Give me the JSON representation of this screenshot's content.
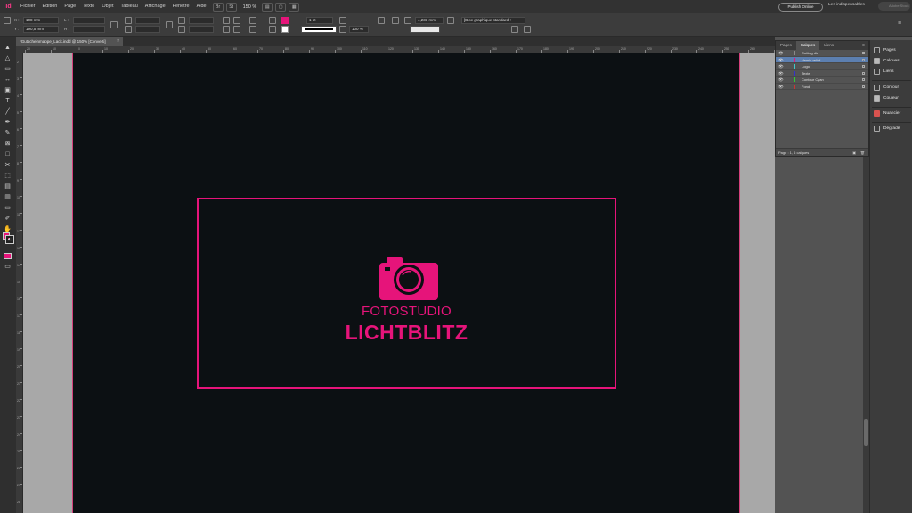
{
  "app": {
    "logo": "Id"
  },
  "menu": [
    "Fichier",
    "Edition",
    "Page",
    "Texte",
    "Objet",
    "Tableau",
    "Affichage",
    "Fenêtre",
    "Aide"
  ],
  "menubar": {
    "zoom": "150 %",
    "publish": "Publish Online",
    "workspace": "Les indispensables",
    "search_placeholder": "Adobe Stock"
  },
  "control": {
    "x_label": "X :",
    "x_value": "108 mm",
    "y_label": "Y :",
    "y_value": "190,5 mm",
    "l_label": "L :",
    "h_label": "H :",
    "stroke_weight": "1 pt",
    "scale_value": "100 %",
    "dim_value": "4,233 mm",
    "style_value": "[Bloc graphique standard]+"
  },
  "document": {
    "tab_title": "*Gutscheinmappe_Lack.indd @ 150% [Converti]"
  },
  "ruler": {
    "h_ticks": [
      "20",
      "10",
      "0",
      "10",
      "20",
      "30",
      "40",
      "50",
      "60",
      "70",
      "80",
      "90",
      "100",
      "110",
      "120",
      "130",
      "140",
      "150",
      "160",
      "170",
      "180",
      "190",
      "200",
      "210",
      "220",
      "230",
      "240",
      "250",
      "260",
      "270"
    ],
    "v_ticks": [
      "2",
      "3",
      "4",
      "5",
      "6",
      "7",
      "8",
      "9",
      "10",
      "11",
      "12",
      "13",
      "14",
      "15",
      "16",
      "17",
      "18",
      "19",
      "20",
      "21",
      "22",
      "23",
      "24",
      "25",
      "26",
      "27",
      "28"
    ]
  },
  "artwork": {
    "line1": "FOTOSTUDIO",
    "line2": "LICHTBLITZ",
    "brand_color": "#e6147a"
  },
  "layers_panel": {
    "tabs": [
      "Pages",
      "Calques",
      "Liens"
    ],
    "active_tab": "Calques",
    "layers": [
      {
        "name": "Cutting die",
        "color": "#8a8a8a",
        "selected": false
      },
      {
        "name": "Vernis-relief",
        "color": "#e6147a",
        "selected": true
      },
      {
        "name": "Logo",
        "color": "#3cc8c8",
        "selected": false
      },
      {
        "name": "Texte",
        "color": "#3333cc",
        "selected": false
      },
      {
        "name": "Contour Cyan",
        "color": "#33cc33",
        "selected": false
      },
      {
        "name": "Fond",
        "color": "#cc3333",
        "selected": false
      }
    ],
    "footer": "Page : 1, 6 calques"
  },
  "dock": {
    "items": [
      {
        "label": "Pages",
        "icon": "pages-icon"
      },
      {
        "label": "Calques",
        "icon": "layers-icon"
      },
      {
        "label": "Liens",
        "icon": "links-icon"
      },
      {
        "label": "Contour",
        "icon": "stroke-icon"
      },
      {
        "label": "Couleur",
        "icon": "color-icon"
      },
      {
        "label": "Nuancier",
        "icon": "swatches-icon"
      },
      {
        "label": "Dégradé",
        "icon": "gradient-icon"
      }
    ]
  },
  "colors": {
    "fill_swatch": "#e6147a",
    "page_bg": "#0c1013",
    "selection_blue": "#5c7fb0"
  }
}
